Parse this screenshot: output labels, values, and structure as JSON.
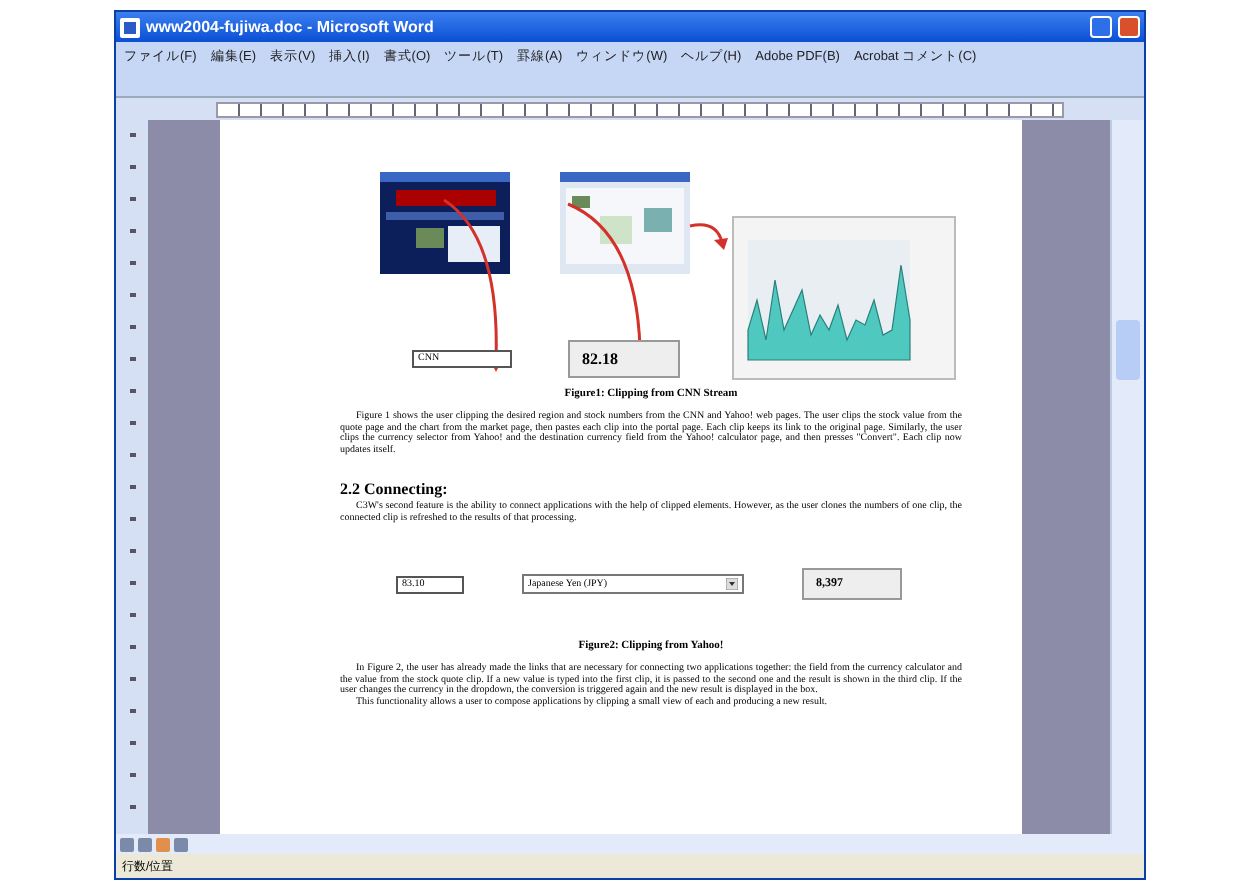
{
  "window": {
    "title": "www2004-fujiwa.doc - Microsoft Word"
  },
  "menu": [
    "ファイル(F)",
    "編集(E)",
    "表示(V)",
    "挿入(I)",
    "書式(O)",
    "ツール(T)",
    "罫線(A)",
    "ウィンドウ(W)",
    "ヘルプ(H)",
    "Adobe PDF(B)",
    "Acrobat コメント(C)"
  ],
  "document": {
    "figure1": {
      "field_value": "CNN",
      "box_value": "82.18",
      "caption": "Figure1: Clipping from CNN Stream"
    },
    "paragraph1": "Figure 1 shows the user clipping the desired region and stock numbers from the CNN and Yahoo! web pages. The user clips the stock value from the quote page and the chart from the market page, then pastes each clip into the portal page. Each clip keeps its link to the original page. Similarly, the user clips the currency selector from Yahoo! and the destination currency field from the Yahoo! calculator page, and then presses \"Convert\". Each clip now updates itself.",
    "heading": "2.2 Connecting:",
    "paragraph2": "C3W's second feature is the ability to connect applications with the help of clipped elements. However, as the user clones the numbers of one clip, the connected clip is refreshed to the results of that processing.",
    "figure2": {
      "field_value": "83.10",
      "dropdown_value": "Japanese Yen (JPY)",
      "box_value": "8,397",
      "caption": "Figure2: Clipping from Yahoo!"
    },
    "paragraph3": "In Figure 2, the user has already made the links that are necessary for connecting two applications together: the field from the currency calculator and the value from the stock quote clip. If a new value is typed into the first clip, it is passed to the second one and the result is shown in the third clip. If the user changes the currency in the dropdown, the conversion is triggered again and the new result is displayed in the box.",
    "paragraph4": "This functionality allows a user to compose applications by clipping a small view of each and producing a new result."
  },
  "status_bar": "行数/位置"
}
